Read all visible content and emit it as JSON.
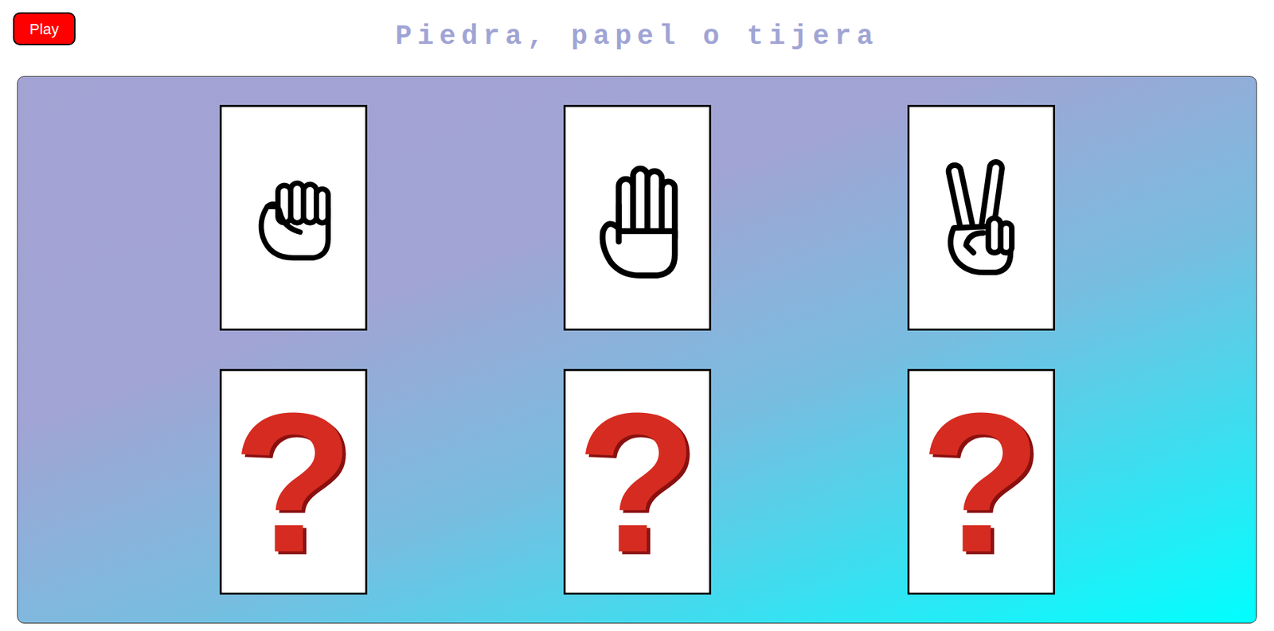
{
  "play_button": {
    "label": "Play"
  },
  "title": "Piedra, papel o tijera",
  "player_cards": [
    {
      "kind": "rock"
    },
    {
      "kind": "paper"
    },
    {
      "kind": "scissors"
    }
  ],
  "cpu_cards": [
    {
      "symbol": "?",
      "hidden": true
    },
    {
      "symbol": "?",
      "hidden": true
    },
    {
      "symbol": "?",
      "hidden": true
    }
  ]
}
